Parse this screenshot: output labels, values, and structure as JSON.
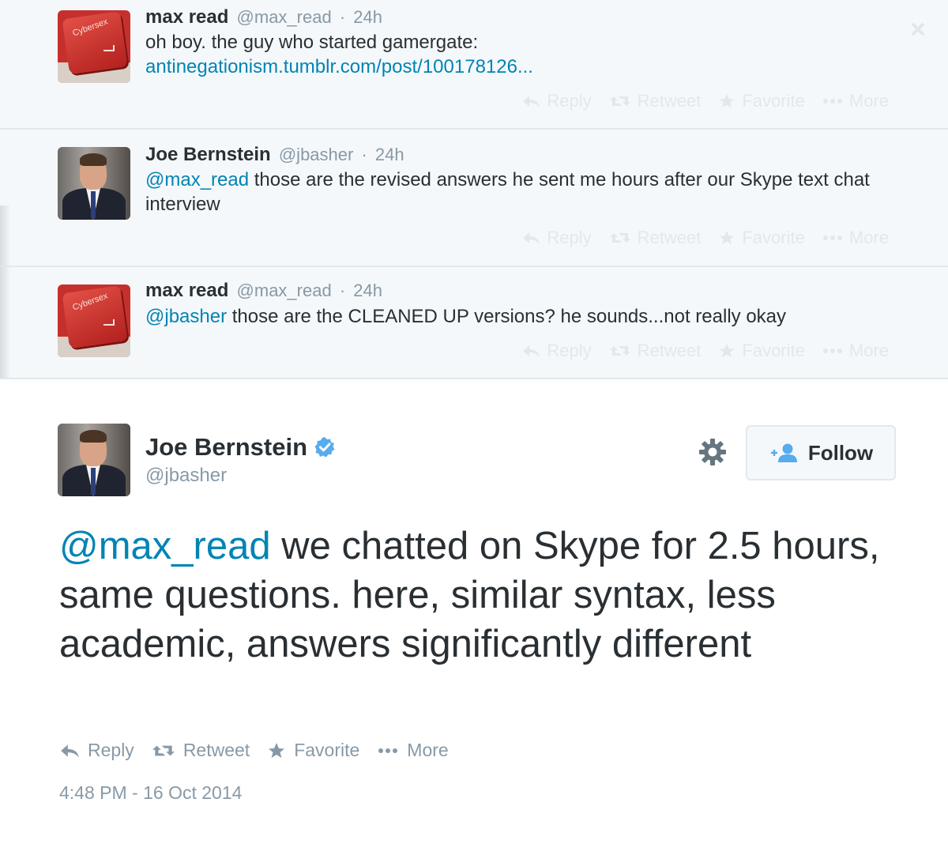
{
  "thread": [
    {
      "name": "max read",
      "handle": "@max_read",
      "time": "24h",
      "avatar": "cybersex-key-avatar",
      "avatar_label": "Cybersex",
      "text_parts": {
        "plain": "oh boy. the guy who started gamergate:",
        "link": "antinegationism.tumblr.com/post/100178126..."
      }
    },
    {
      "name": "Joe Bernstein",
      "handle": "@jbasher",
      "time": "24h",
      "avatar": "joe-portrait-avatar",
      "text_parts": {
        "mention": "@max_read",
        "plain": " those are the revised answers he sent me hours after our Skype text chat interview"
      }
    },
    {
      "name": "max read",
      "handle": "@max_read",
      "time": "24h",
      "avatar": "cybersex-key-avatar",
      "avatar_label": "Cybersex",
      "text_parts": {
        "mention": "@jbasher",
        "plain": " those are the CLEANED UP versions? he sounds...not really okay"
      }
    }
  ],
  "actions": {
    "reply": "Reply",
    "retweet": "Retweet",
    "favorite": "Favorite",
    "more": "More"
  },
  "main": {
    "name": "Joe Bernstein",
    "handle": "@jbasher",
    "verified": true,
    "follow_label": "Follow",
    "mention": "@max_read",
    "text": " we chatted on Skype for 2.5 hours, same questions. here, similar syntax, less academic, answers significantly different",
    "timestamp": "4:48 PM - 16 Oct 2014"
  },
  "colors": {
    "link": "#0084b4",
    "muted": "#8899a6",
    "faint": "#e1e8ed",
    "verified": "#55acee",
    "follow_icon": "#55acee"
  }
}
